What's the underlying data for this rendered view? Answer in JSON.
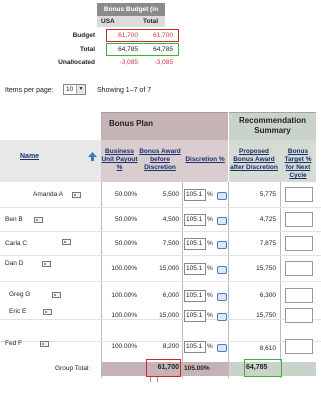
{
  "budget_summary": {
    "title": "Bonus Budget (in USD)",
    "columns": [
      "USA",
      "Total"
    ],
    "rows": [
      {
        "label": "Budget",
        "usa": "61,700",
        "total": "61,700"
      },
      {
        "label": "Total",
        "usa": "64,785",
        "total": "64,785"
      },
      {
        "label": "Unallocated",
        "usa": "-3,085",
        "total": "-3,085"
      }
    ]
  },
  "pager": {
    "label": "Items per page:",
    "value": "10",
    "status": "Showing 1–7 of 7"
  },
  "groups": {
    "bonus_plan": "Bonus Plan",
    "recommendation": "Recommendation Summary"
  },
  "columns": {
    "name": "Name",
    "business_unit_payout": "Business Unit Payout %",
    "bonus_award_before": "Bonus Award before Discretion",
    "discretion": "Discretion %",
    "proposed_award": "Proposed Bonus Award after Discretion",
    "bonus_target_next": "Bonus Target % for Next Cycle"
  },
  "rows": [
    {
      "name": "Amanda A",
      "payout": "50.00%",
      "before": "5,500",
      "discretion": "105.1",
      "pct_sign": "%",
      "proposed": "5,775"
    },
    {
      "name": "Ben B",
      "payout": "50.00%",
      "before": "4,500",
      "discretion": "105.1",
      "pct_sign": "%",
      "proposed": "4,725"
    },
    {
      "name": "Carla C",
      "payout": "50.00%",
      "before": "7,500",
      "discretion": "105.1",
      "pct_sign": "%",
      "proposed": "7,875"
    },
    {
      "name": "Dan D",
      "payout": "100.00%",
      "before": "15,000",
      "discretion": "105.1",
      "pct_sign": "%",
      "proposed": "15,750"
    },
    {
      "name": "Greg G",
      "payout": "100.00%",
      "before": "6,000",
      "discretion": "105.1",
      "pct_sign": "%",
      "proposed": "6,300"
    },
    {
      "name": "Eric E",
      "payout": "100.00%",
      "before": "15,000",
      "discretion": "105.1",
      "pct_sign": "%",
      "proposed": "15,750"
    },
    {
      "name": "Fed F",
      "payout": "100.00%",
      "before": "8,200",
      "discretion": "105.1",
      "pct_sign": "%",
      "proposed": "8,610"
    }
  ],
  "totals": {
    "label": "Group Total:",
    "before": "61,700",
    "discretion": "105.00%",
    "proposed": "64,785"
  },
  "icons": {
    "sort": "sort-arrow-icon",
    "contact": "contact-card-icon",
    "comment": "comment-bubble-icon"
  },
  "colors": {
    "highlight_red": "#d4262b",
    "highlight_green": "#3cb043",
    "bonus_plan_bg": "#c5b3b5",
    "recommendation_bg": "#c9d3c9",
    "negative_text": "#d23a3a"
  }
}
